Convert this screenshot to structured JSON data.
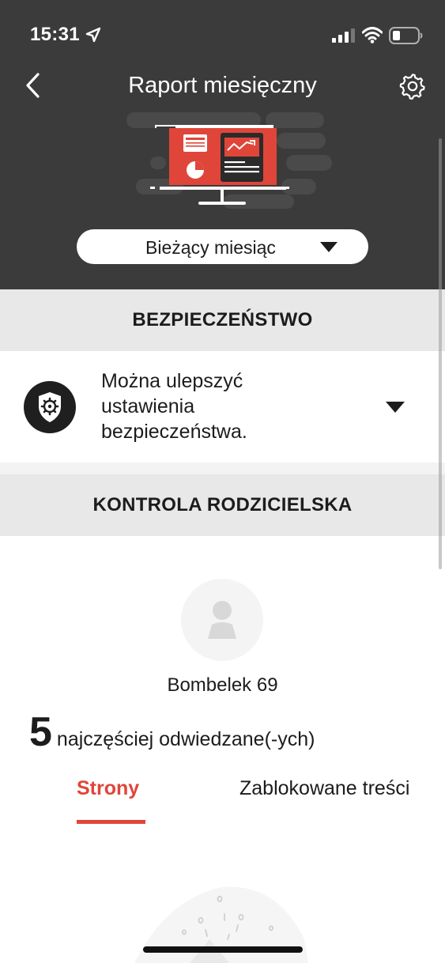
{
  "status_bar": {
    "time": "15:31"
  },
  "header": {
    "title": "Raport miesięczny"
  },
  "period_selector": {
    "selected": "Bieżący miesiąc"
  },
  "security_section": {
    "heading": "BEZPIECZEŃSTWO",
    "message_line1": "Można ulepszyć",
    "message_line2": "ustawienia",
    "message_line3": "bezpieczeństwa."
  },
  "parental_section": {
    "heading": "KONTROLA RODZICIELSKA",
    "child_name": "Bombelek 69",
    "most_visited_count": "5",
    "most_visited_label": "najczęściej odwiedzane(-ych)",
    "tabs": [
      {
        "label": "Strony",
        "active": true
      },
      {
        "label": "Zablokowane treści",
        "active": false
      }
    ]
  },
  "colors": {
    "header_bg": "#3b3b3b",
    "accent": "#e0453a",
    "section_bg": "#e8e8e8"
  }
}
